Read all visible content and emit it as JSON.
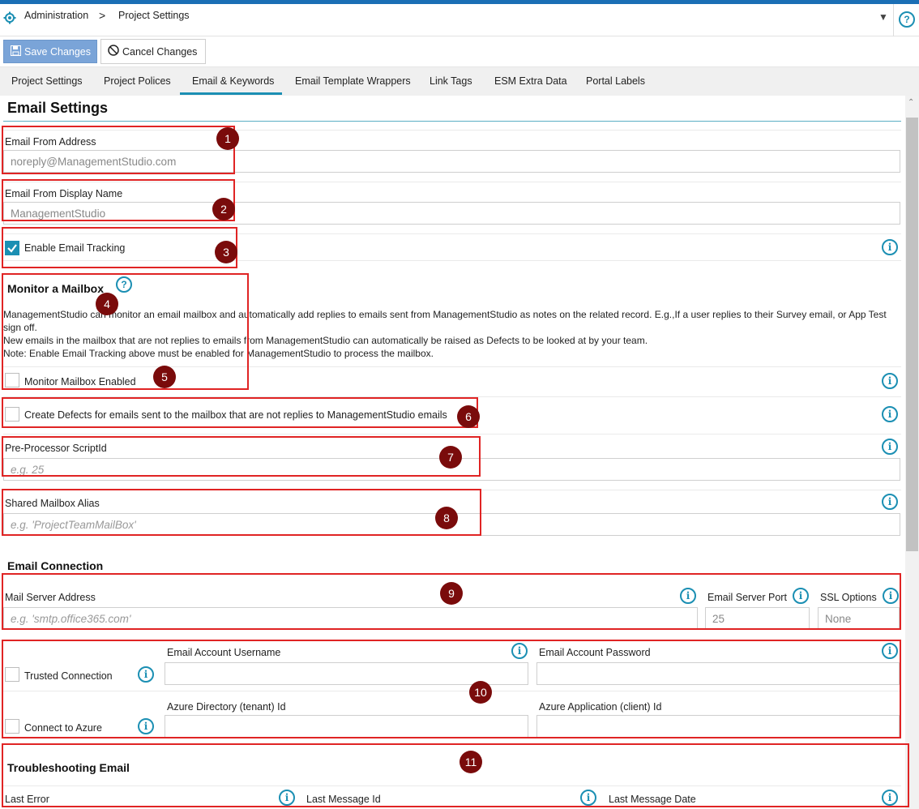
{
  "breadcrumb": {
    "root": "Administration",
    "separator": ">",
    "current": "Project Settings"
  },
  "toolbar": {
    "save_label": "Save Changes",
    "cancel_label": "Cancel Changes"
  },
  "tabs": [
    {
      "label": "Project Settings"
    },
    {
      "label": "Project Polices"
    },
    {
      "label": "Email & Keywords",
      "active": true
    },
    {
      "label": "Email Template Wrappers"
    },
    {
      "label": "Link Tags"
    },
    {
      "label": "ESM Extra Data"
    },
    {
      "label": "Portal Labels"
    }
  ],
  "colors": {
    "accent": "#1b8fb3",
    "annotation_box": "#e02424",
    "badge": "#7a0b0b"
  },
  "email_settings": {
    "title": "Email Settings",
    "from_address": {
      "label": "Email From Address",
      "value": "noreply@ManagementStudio.com"
    },
    "from_display_name": {
      "label": "Email From Display Name",
      "value": "ManagementStudio"
    },
    "enable_tracking": {
      "label": "Enable Email Tracking",
      "checked": true
    },
    "monitor": {
      "heading": "Monitor a Mailbox",
      "desc1": "ManagementStudio can monitor an email mailbox and automatically add replies to emails sent from ManagementStudio as notes on the related record. E.g.,If a user replies to their Survey email, or App Test",
      "desc1b": "sign off.",
      "desc2": "New emails in the mailbox that are not replies to emails from ManagementStudio can automatically be raised as Defects to be looked at by your team.",
      "desc3": "Note: Enable Email Tracking above must be enabled for ManagementStudio to process the mailbox.",
      "enabled_label": "Monitor Mailbox Enabled",
      "create_defects_label": "Create Defects for emails sent to the mailbox that are not replies to ManagementStudio emails"
    },
    "preprocessor": {
      "label": "Pre-Processor ScriptId",
      "placeholder": "e.g. 25"
    },
    "shared_alias": {
      "label": "Shared Mailbox Alias",
      "placeholder": "e.g. 'ProjectTeamMailBox'"
    }
  },
  "connection": {
    "heading": "Email Connection",
    "server_address": {
      "label": "Mail Server Address",
      "placeholder": "e.g. 'smtp.office365.com'"
    },
    "server_port": {
      "label": "Email Server Port",
      "value": "25"
    },
    "ssl": {
      "label": "SSL Options",
      "value": "None"
    },
    "trusted_label": "Trusted Connection",
    "username_label": "Email Account Username",
    "password_label": "Email Account Password",
    "azure_label": "Connect to Azure",
    "tenant_label": "Azure Directory (tenant) Id",
    "client_label": "Azure Application (client) Id"
  },
  "troubleshooting": {
    "heading": "Troubleshooting Email",
    "last_error": "Last Error",
    "last_message_id": "Last Message Id",
    "last_message_date": "Last Message Date"
  },
  "badges": [
    "1",
    "2",
    "3",
    "4",
    "5",
    "6",
    "7",
    "8",
    "9",
    "10",
    "11"
  ],
  "icons": {
    "settings": "gear-icon",
    "help": "question-circle-icon",
    "info": "info-circle-icon",
    "save": "floppy-icon",
    "cancel": "ban-icon",
    "filter": "filter-icon"
  }
}
